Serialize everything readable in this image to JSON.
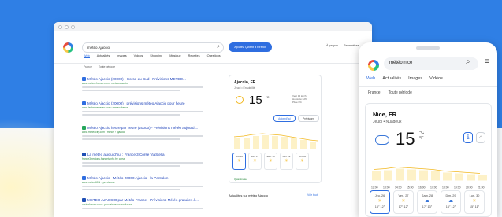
{
  "browser": {
    "search_value": "météo Ajaccio",
    "cta_label": "Ajoutez Qwant à Firefox",
    "top_right": [
      "À propos",
      "Paramètres"
    ],
    "tabs": [
      "Web",
      "Actualités",
      "Images",
      "Vidéos",
      "Shopping",
      "Musique",
      "Recettes",
      "Questions"
    ],
    "filters": [
      "France",
      "Toute période"
    ],
    "results": [
      {
        "title": "Météo Ajaccio (20000) - Corse-du-Sud : Prévisions METEO...",
        "url": "www.meteo-france.com › meteo-ajaccio"
      },
      {
        "title": "Météo Ajaccio (20000) : prévisions météo Ajaccio pour heure",
        "url": "www.lachainemeteo.com › meteo-france"
      },
      {
        "title": "Météo Ajaccio heure par heure (20000) - Prévisions météo aujourd'...",
        "url": "www.meteocity.com › france › ajaccio"
      },
      {
        "title": "La météo aujourd'hui : France 3 Corse ViaStella",
        "url": "france3-regions.francetvinfo.fr › corse"
      },
      {
        "title": "Météo Ajaccio - Météo 20000 Ajaccio - la Pantalon",
        "url": "www.meteo60.fr › previsions"
      },
      {
        "title": "METEO AJACCIO par Météo-France - Prévisions Météo gratuites à...",
        "url": "meteofrance.com › previsions-meteo-france"
      }
    ],
    "card": {
      "city": "Ajaccio, FR",
      "date": "Jeudi • Ensoleillé",
      "temp": "15",
      "unit": "°C",
      "stats": [
        "Vent 12 km/h",
        "Humidité 62%",
        "Pluie 0%"
      ],
      "btn_hourly": "Aujourd'hui",
      "btn_forecast": "Prévisions",
      "days": [
        "Jeu. 26",
        "Ven. 27",
        "Sam. 28",
        "Dim. 29",
        "Lun. 30"
      ],
      "source": "Qwantmeteo"
    },
    "news_title": "Actualités sur météo Ajaccio",
    "news_all": "Voir tout"
  },
  "phone": {
    "search_value": "météo nice",
    "tabs": [
      "Web",
      "Actualités",
      "Images",
      "Vidéos"
    ],
    "filters": [
      "France",
      "Toute période"
    ],
    "card": {
      "city": "Nice, FR",
      "date": "Jeudi • Nuageux",
      "temp": "15",
      "unit": "°C",
      "unit_f": "°F",
      "hours": [
        "12:00",
        "13:00",
        "14:00",
        "15:00",
        "16:00",
        "17:00",
        "18:00",
        "19:00",
        "20:00",
        "21:00"
      ],
      "days": [
        "Jeu. 26",
        "Ven. 27",
        "Sam. 28",
        "Dim. 29",
        "Lun. 30"
      ],
      "day_temps": [
        "16° 12°",
        "17° 12°",
        "17° 13°",
        "16° 12°",
        "15° 11°"
      ]
    }
  }
}
